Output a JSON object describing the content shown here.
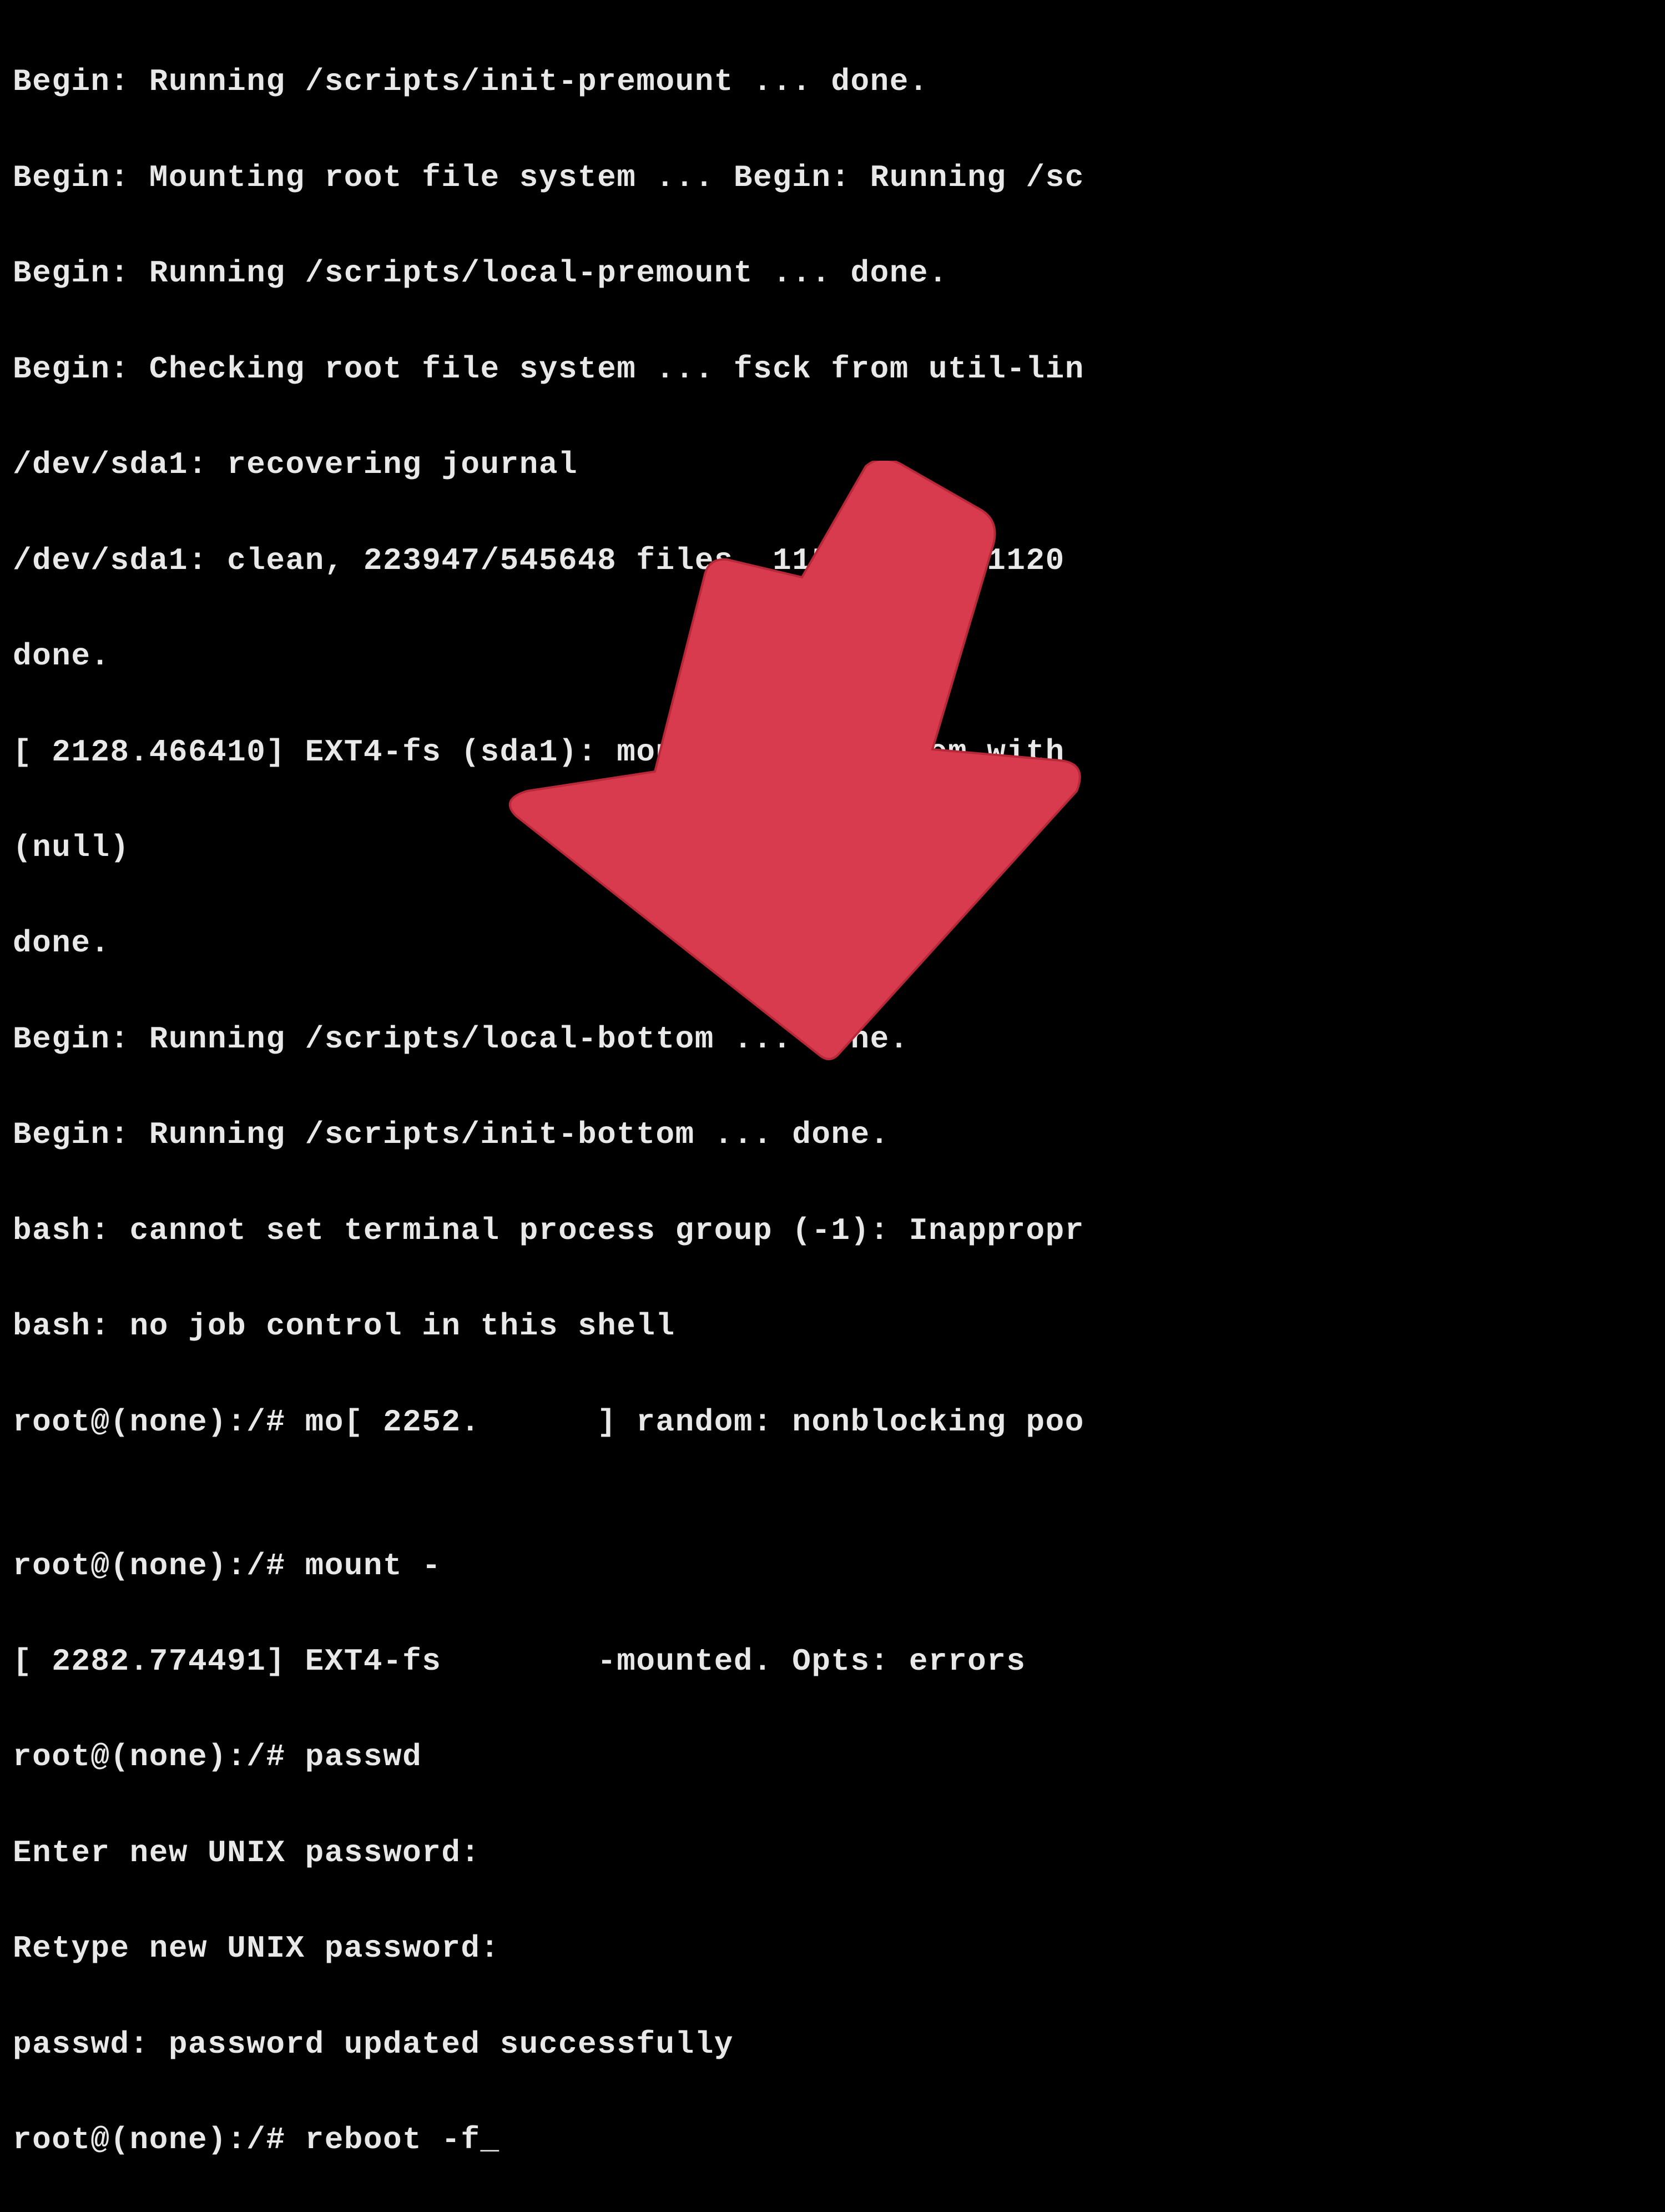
{
  "terminal": {
    "lines": [
      "Begin: Running /scripts/init-premount ... done.",
      "Begin: Mounting root file system ... Begin: Running /sc",
      "Begin: Running /scripts/local-premount ... done.",
      "Begin: Checking root file system ... fsck from util-lin",
      "/dev/sda1: recovering journal",
      "/dev/sda1: clean, 223947/545648 files, 1155127/2181120 ",
      "done.",
      "[ 2128.466410] EXT4-fs (sda1): mounted filesystem with ",
      "(null)",
      "done.",
      "Begin: Running /scripts/local-bottom ... done.",
      "Begin: Running /scripts/init-bottom ... done.",
      "bash: cannot set terminal process group (-1): Inappropr",
      "bash: no job control in this shell",
      "root@(none):/# mo[ 2252.      ] random: nonblocking poo",
      "",
      "root@(none):/# mount -",
      "[ 2282.774491] EXT4-fs        -mounted. Opts: errors",
      "root@(none):/# passwd",
      "Enter new UNIX password:",
      "Retype new UNIX password:",
      "passwd: password updated successfully",
      "root@(none):/# reboot -f_"
    ]
  },
  "annotation": {
    "arrow_color": "#d83a4e",
    "arrow_target": "reboot command"
  }
}
